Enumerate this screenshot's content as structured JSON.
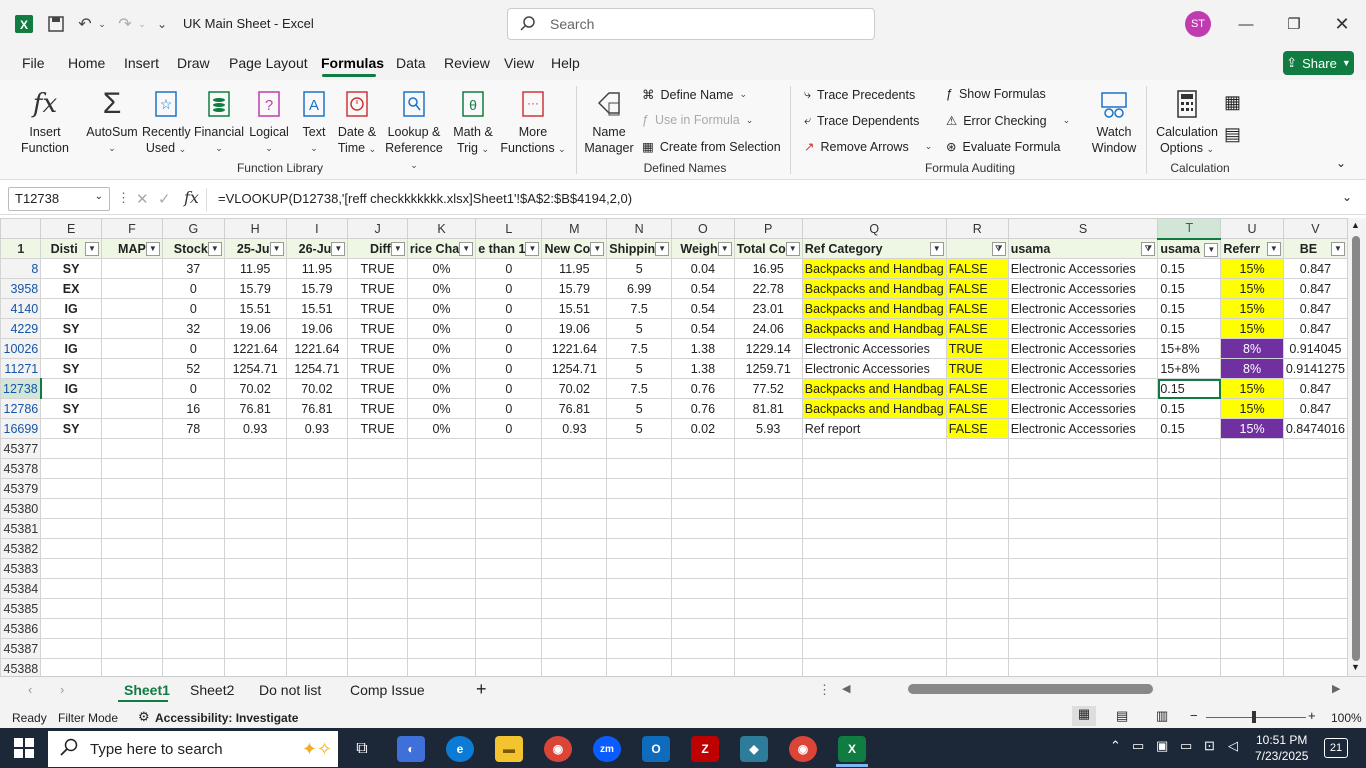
{
  "window": {
    "title": "UK Main Sheet  -  Excel",
    "search_placeholder": "Search",
    "avatar": "ST"
  },
  "menu": [
    "File",
    "Home",
    "Insert",
    "Draw",
    "Page Layout",
    "Formulas",
    "Data",
    "Review",
    "View",
    "Help"
  ],
  "share_label": "Share",
  "ribbon": {
    "insert_function": [
      "Insert",
      "Function"
    ],
    "autosum": "AutoSum",
    "recently_used": [
      "Recently",
      "Used"
    ],
    "financial": "Financial",
    "logical": "Logical",
    "text": "Text",
    "date_time": [
      "Date &",
      "Time"
    ],
    "lookup": [
      "Lookup &",
      "Reference"
    ],
    "math": [
      "Math &",
      "Trig"
    ],
    "more": [
      "More",
      "Functions"
    ],
    "function_library": "Function Library",
    "name_manager": [
      "Name",
      "Manager"
    ],
    "define_name": "Define Name",
    "use_in_formula": "Use in Formula",
    "create_from_selection": "Create from Selection",
    "defined_names": "Defined Names",
    "trace_precedents": "Trace Precedents",
    "trace_dependents": "Trace Dependents",
    "remove_arrows": "Remove Arrows",
    "show_formulas": "Show Formulas",
    "error_checking": "Error Checking",
    "evaluate_formula": "Evaluate Formula",
    "watch_window": [
      "Watch",
      "Window"
    ],
    "formula_auditing": "Formula Auditing",
    "calc_options": [
      "Calculation",
      "Options"
    ],
    "calculation": "Calculation"
  },
  "formula_bar": {
    "name_box": "T12738",
    "formula": "=VLOOKUP(D12738,'[reff checkkkkkkk.xlsx]Sheet1'!$A$2:$B$4194,2,0)"
  },
  "columns": [
    "E",
    "F",
    "G",
    "H",
    "I",
    "J",
    "K",
    "L",
    "M",
    "N",
    "O",
    "P",
    "Q",
    "R",
    "S",
    "T",
    "U",
    "V"
  ],
  "header_row": {
    "num": "1",
    "cells": [
      "Disti",
      "MAP",
      "Stock",
      "25-Ju",
      "26-Ju",
      "Diff",
      "rice Cha",
      "e than 1",
      "New Co",
      "Shippin",
      "Weigh",
      "Total Co",
      "Ref Category",
      "",
      "usama",
      "usama",
      "Referr",
      "BE"
    ]
  },
  "rows": [
    {
      "num": "8",
      "cells": [
        "SY",
        "",
        "37",
        "11.95",
        "11.95",
        "TRUE",
        "0%",
        "0",
        "11.95",
        "5",
        "0.04",
        "16.95",
        "Backpacks and Handbag",
        "FALSE",
        "Electronic Accessories",
        "0.15",
        "15%",
        "0.847"
      ]
    },
    {
      "num": "3958",
      "cells": [
        "EX",
        "",
        "0",
        "15.79",
        "15.79",
        "TRUE",
        "0%",
        "0",
        "15.79",
        "6.99",
        "0.54",
        "22.78",
        "Backpacks and Handbag",
        "FALSE",
        "Electronic Accessories",
        "0.15",
        "15%",
        "0.847"
      ]
    },
    {
      "num": "4140",
      "cells": [
        "IG",
        "",
        "0",
        "15.51",
        "15.51",
        "TRUE",
        "0%",
        "0",
        "15.51",
        "7.5",
        "0.54",
        "23.01",
        "Backpacks and Handbag",
        "FALSE",
        "Electronic Accessories",
        "0.15",
        "15%",
        "0.847"
      ]
    },
    {
      "num": "4229",
      "cells": [
        "SY",
        "",
        "32",
        "19.06",
        "19.06",
        "TRUE",
        "0%",
        "0",
        "19.06",
        "5",
        "0.54",
        "24.06",
        "Backpacks and Handbag",
        "FALSE",
        "Electronic Accessories",
        "0.15",
        "15%",
        "0.847"
      ]
    },
    {
      "num": "10026",
      "cells": [
        "IG",
        "",
        "0",
        "1221.64",
        "1221.64",
        "TRUE",
        "0%",
        "0",
        "1221.64",
        "7.5",
        "1.38",
        "1229.14",
        "Electronic Accessories",
        "TRUE",
        "Electronic Accessories",
        "15+8%",
        "8%",
        "0.914045"
      ]
    },
    {
      "num": "11271",
      "cells": [
        "SY",
        "",
        "52",
        "1254.71",
        "1254.71",
        "TRUE",
        "0%",
        "0",
        "1254.71",
        "5",
        "1.38",
        "1259.71",
        "Electronic Accessories",
        "TRUE",
        "Electronic Accessories",
        "15+8%",
        "8%",
        "0.9141275"
      ]
    },
    {
      "num": "12738",
      "cells": [
        "IG",
        "",
        "0",
        "70.02",
        "70.02",
        "TRUE",
        "0%",
        "0",
        "70.02",
        "7.5",
        "0.76",
        "77.52",
        "Backpacks and Handbag",
        "FALSE",
        "Electronic Accessories",
        "0.15",
        "15%",
        "0.847"
      ]
    },
    {
      "num": "12786",
      "cells": [
        "SY",
        "",
        "16",
        "76.81",
        "76.81",
        "TRUE",
        "0%",
        "0",
        "76.81",
        "5",
        "0.76",
        "81.81",
        "Backpacks and Handbag",
        "FALSE",
        "Electronic Accessories",
        "0.15",
        "15%",
        "0.847"
      ]
    },
    {
      "num": "16699",
      "cells": [
        "SY",
        "",
        "78",
        "0.93",
        "0.93",
        "TRUE",
        "0%",
        "0",
        "0.93",
        "5",
        "0.02",
        "5.93",
        "Ref report",
        "FALSE",
        "Electronic Accessories",
        "0.15",
        "15%",
        "0.8474016"
      ]
    }
  ],
  "empty_rows": [
    "45377",
    "45378",
    "45379",
    "45380",
    "45381",
    "45382",
    "45383",
    "45384",
    "45385",
    "45386",
    "45387",
    "45388"
  ],
  "sheets": [
    "Sheet1",
    "Sheet2",
    "Do not list",
    "Comp Issue"
  ],
  "status": {
    "ready": "Ready",
    "filter_mode": "Filter Mode",
    "accessibility": "Accessibility: Investigate",
    "zoom": "100%"
  },
  "taskbar": {
    "search_placeholder": "Type here to search",
    "time": "10:51 PM",
    "date": "7/23/2025",
    "notifications": "21"
  }
}
